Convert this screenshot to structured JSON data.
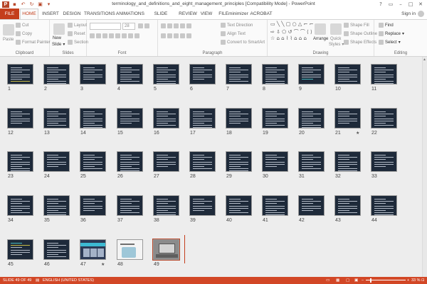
{
  "title_bar": {
    "document_title": "terminology_and_definitions_and_eight_management_principles [Compatibility Mode] - PowerPoint",
    "app_logo_letter": "P",
    "qat_icons": [
      "save-icon",
      "undo-icon",
      "redo-icon",
      "start-slideshow-icon",
      "customize-qat-icon"
    ],
    "window_controls": [
      "?",
      "▭",
      "–",
      "□",
      "✕"
    ]
  },
  "tabs": {
    "file": "FILE",
    "items": [
      "HOME",
      "INSERT",
      "DESIGN",
      "TRANSITIONS",
      "ANIMATIONS",
      "SLIDE SHOW",
      "REVIEW",
      "VIEW",
      "FILEminimizer",
      "ACROBAT"
    ],
    "active": "HOME",
    "sign_in": "Sign in"
  },
  "ribbon": {
    "clipboard": {
      "label": "Clipboard",
      "paste": "Paste",
      "cut": "Cut",
      "copy": "Copy",
      "format_painter": "Format Painter"
    },
    "slides": {
      "label": "Slides",
      "new_slide": "New",
      "new_slide_2": "Slide",
      "layout": "Layout",
      "reset": "Reset",
      "section": "Section"
    },
    "font": {
      "label": "Font",
      "size": "28"
    },
    "paragraph": {
      "label": "Paragraph",
      "text_direction": "Text Direction",
      "align_text": "Align Text",
      "convert_smartart": "Convert to SmartArt"
    },
    "drawing": {
      "label": "Drawing",
      "arrange": "Arrange",
      "quick_styles": "Quick",
      "quick_styles_2": "Styles",
      "shape_fill": "Shape Fill",
      "shape_outline": "Shape Outline",
      "shape_effects": "Shape Effects"
    },
    "editing": {
      "label": "Editing",
      "find": "Find",
      "replace": "Replace",
      "select": "Select"
    }
  },
  "slides": {
    "numbers": [
      "1",
      "2",
      "3",
      "4",
      "5",
      "6",
      "7",
      "8",
      "9",
      "10",
      "11",
      "12",
      "13",
      "14",
      "15",
      "16",
      "17",
      "18",
      "19",
      "20",
      "21",
      "22",
      "23",
      "24",
      "25",
      "26",
      "27",
      "28",
      "29",
      "30",
      "31",
      "32",
      "33",
      "34",
      "35",
      "36",
      "37",
      "38",
      "39",
      "40",
      "41",
      "42",
      "43",
      "44",
      "45",
      "46",
      "47",
      "48",
      "49"
    ],
    "selected": "49",
    "with_animation_star": [
      "21",
      "47"
    ],
    "star_glyph": "★"
  },
  "status_bar": {
    "slide_info": "SLIDE 49 OF 49",
    "language": "ENGLISH (UNITED STATES)",
    "zoom": "33 %",
    "zoom_minus": "–",
    "zoom_plus": "+"
  },
  "colors": {
    "accent": "#c43e1c",
    "status_bar": "#d24726",
    "slide_background": "#1e2a3a"
  }
}
